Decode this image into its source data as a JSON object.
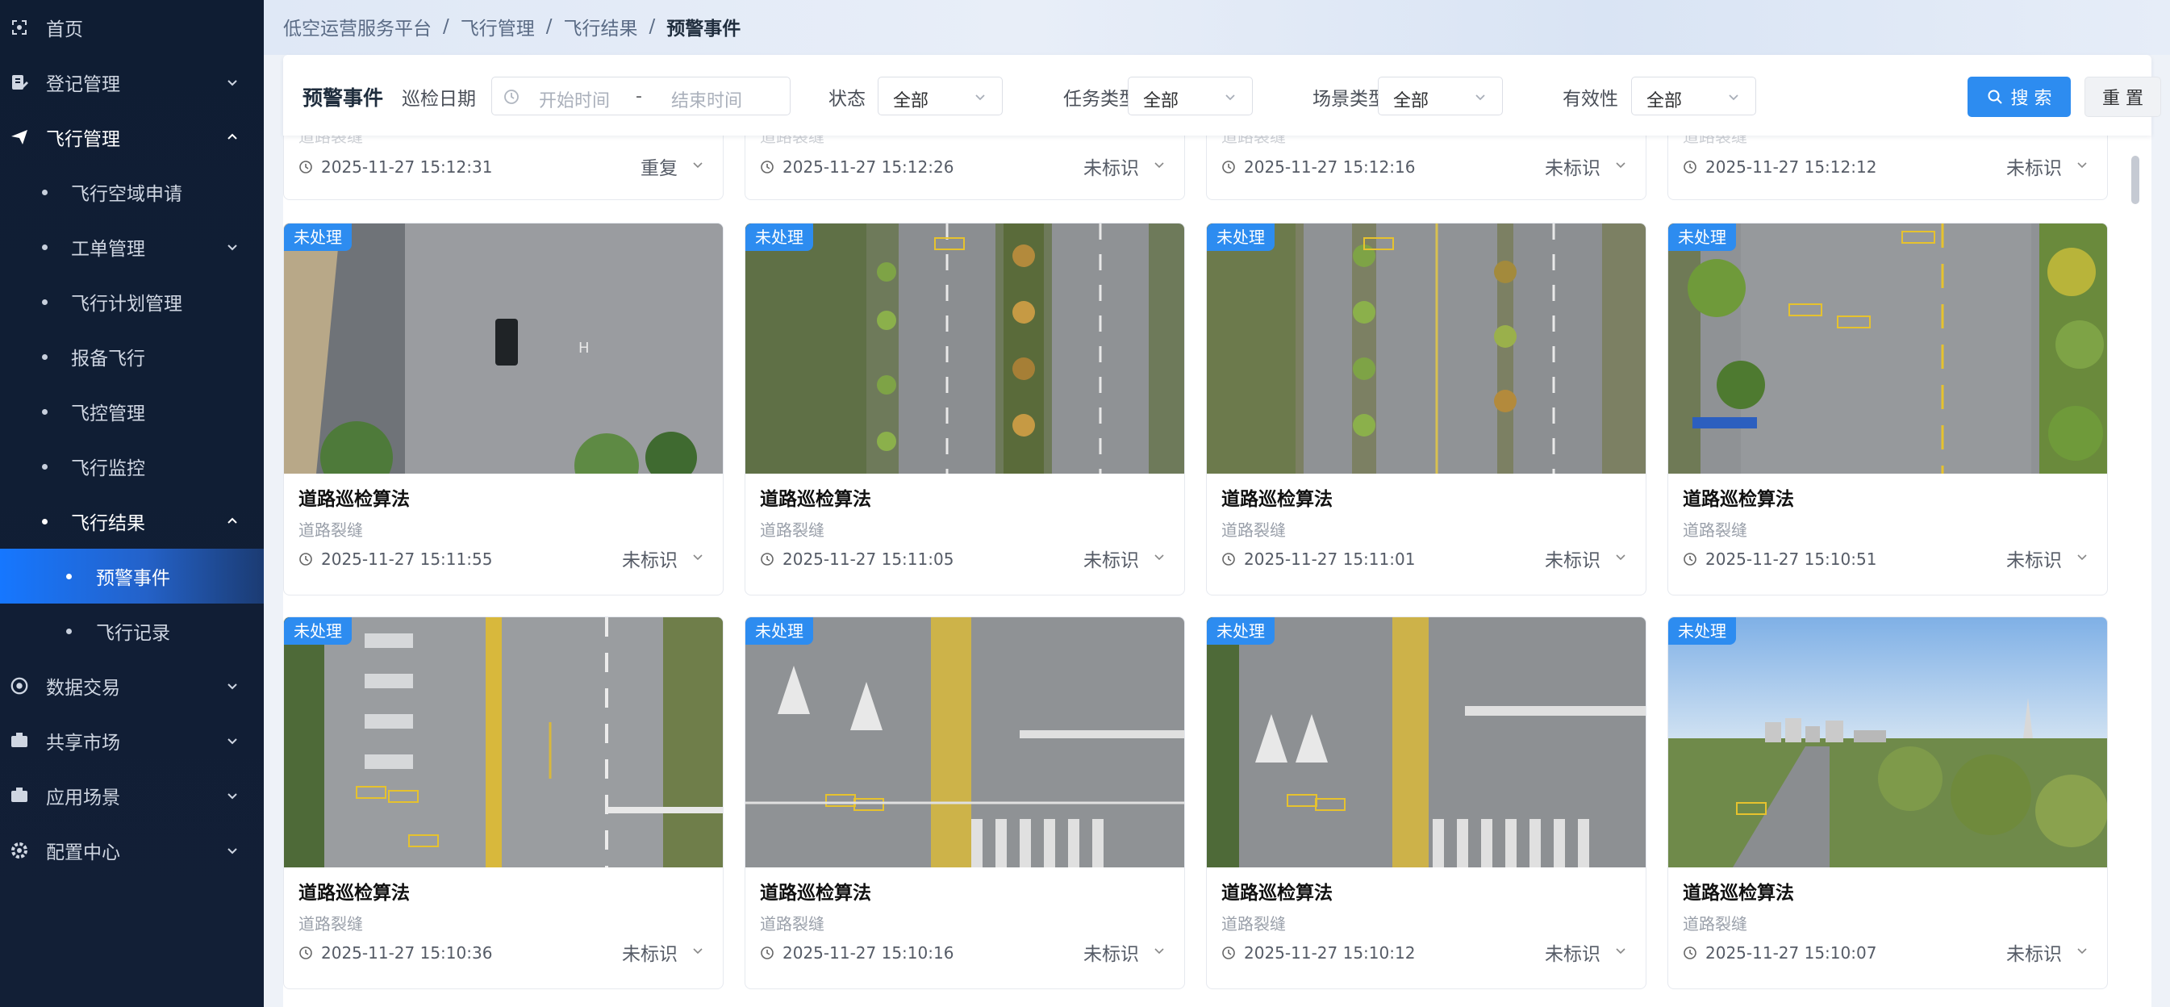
{
  "sidebar": {
    "items": [
      {
        "label": "首页",
        "icon": "home-icon"
      },
      {
        "label": "登记管理",
        "icon": "register-icon"
      },
      {
        "label": "飞行管理",
        "icon": "plane-icon"
      },
      {
        "label": "飞行空域申请"
      },
      {
        "label": "工单管理"
      },
      {
        "label": "飞行计划管理"
      },
      {
        "label": "报备飞行"
      },
      {
        "label": "飞控管理"
      },
      {
        "label": "飞行监控"
      },
      {
        "label": "飞行结果"
      },
      {
        "label": "预警事件"
      },
      {
        "label": "飞行记录"
      },
      {
        "label": "数据交易",
        "icon": "data-trade-icon"
      },
      {
        "label": "共享市场",
        "icon": "share-market-icon"
      },
      {
        "label": "应用场景",
        "icon": "app-scene-icon"
      },
      {
        "label": "配置中心",
        "icon": "settings-icon"
      }
    ]
  },
  "breadcrumb": [
    "低空运营服务平台",
    "飞行管理",
    "飞行结果",
    "预警事件"
  ],
  "filter": {
    "title": "预警事件",
    "date_label": "巡检日期",
    "start_placeholder": "开始时间",
    "range_sep": "-",
    "end_placeholder": "结束时间",
    "status_label": "状态",
    "status_value": "全部",
    "task_label": "任务类型",
    "task_value": "全部",
    "scene_label": "场景类型",
    "scene_value": "全部",
    "valid_label": "有效性",
    "valid_value": "全部",
    "search_label": "搜 索",
    "reset_label": "重 置"
  },
  "top_row": [
    {
      "sub": "道路裂缝",
      "time": "2025-11-27 15:12:31",
      "status": "重复"
    },
    {
      "sub": "道路裂缝",
      "time": "2025-11-27 15:12:26",
      "status": "未标识"
    },
    {
      "sub": "道路裂缝",
      "time": "2025-11-27 15:12:16",
      "status": "未标识"
    },
    {
      "sub": "道路裂缝",
      "time": "2025-11-27 15:12:12",
      "status": "未标识"
    }
  ],
  "cards": [
    {
      "badge": "未处理",
      "title": "道路巡检算法",
      "sub": "道路裂缝",
      "time": "2025-11-27 15:11:55",
      "status": "未标识"
    },
    {
      "badge": "未处理",
      "title": "道路巡检算法",
      "sub": "道路裂缝",
      "time": "2025-11-27 15:11:05",
      "status": "未标识"
    },
    {
      "badge": "未处理",
      "title": "道路巡检算法",
      "sub": "道路裂缝",
      "time": "2025-11-27 15:11:01",
      "status": "未标识"
    },
    {
      "badge": "未处理",
      "title": "道路巡检算法",
      "sub": "道路裂缝",
      "time": "2025-11-27 15:10:51",
      "status": "未标识"
    },
    {
      "badge": "未处理",
      "title": "道路巡检算法",
      "sub": "道路裂缝",
      "time": "2025-11-27 15:10:36",
      "status": "未标识"
    },
    {
      "badge": "未处理",
      "title": "道路巡检算法",
      "sub": "道路裂缝",
      "time": "2025-11-27 15:10:16",
      "status": "未标识"
    },
    {
      "badge": "未处理",
      "title": "道路巡检算法",
      "sub": "道路裂缝",
      "time": "2025-11-27 15:10:12",
      "status": "未标识"
    },
    {
      "badge": "未处理",
      "title": "道路巡检算法",
      "sub": "道路裂缝",
      "time": "2025-11-27 15:10:07",
      "status": "未标识"
    }
  ],
  "colors": {
    "accent": "#2d8cf0",
    "sidebar_bg": "#0f1d33",
    "selected": "#1677ff"
  }
}
